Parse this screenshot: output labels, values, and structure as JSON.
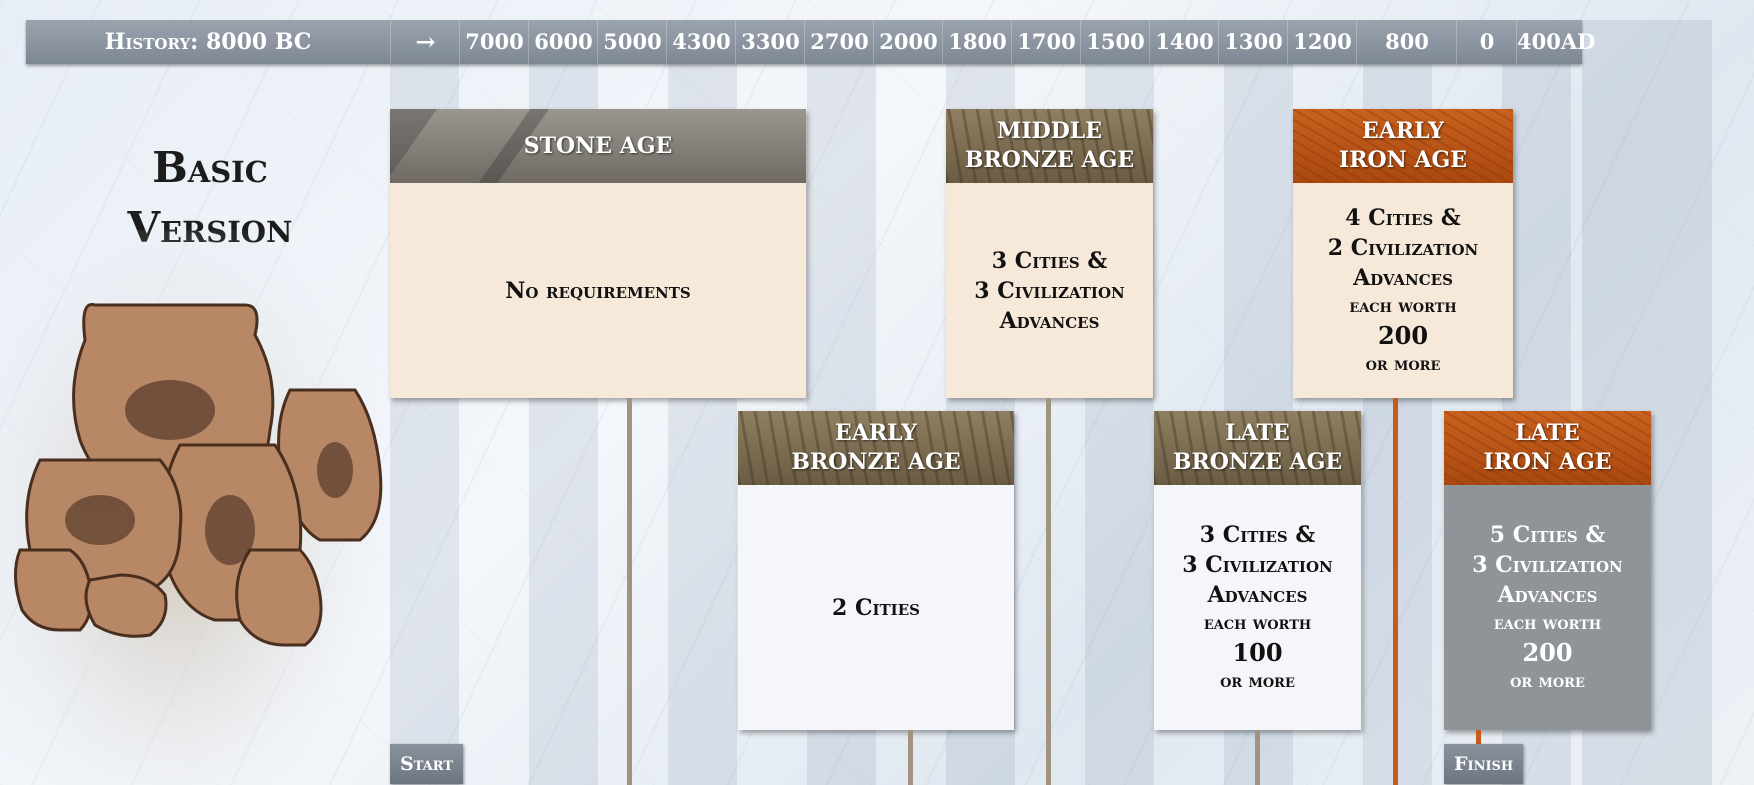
{
  "header": {
    "history_label": "History: 8000 BC",
    "arrow_icon": "→",
    "timeline": [
      "7000",
      "6000",
      "5000",
      "4300",
      "3300",
      "2700",
      "2000",
      "1800",
      "1700",
      "1500",
      "1400",
      "1300",
      "1200",
      "800",
      "0",
      "400AD"
    ]
  },
  "title": {
    "line1": "Basic",
    "line2": "Version"
  },
  "ages": {
    "stone": {
      "name": "STONE AGE",
      "req": "No requirements"
    },
    "early_bronze": {
      "name1": "EARLY",
      "name2": "BRONZE AGE",
      "req": "2 Cities"
    },
    "middle_bronze": {
      "name1": "MIDDLE",
      "name2": "BRONZE AGE",
      "req1": "3 Cities &",
      "req2": "3 Civilization",
      "req3": "Advances"
    },
    "late_bronze": {
      "name1": "LATE",
      "name2": "BRONZE AGE",
      "req1": "3 Cities &",
      "req2": "3 Civilization",
      "req3": "Advances",
      "req4": "each worth",
      "req5": "100",
      "req6": "or more"
    },
    "early_iron": {
      "name1": "EARLY",
      "name2": "IRON AGE",
      "req1": "4 Cities &",
      "req2": "2 Civilization",
      "req3": "Advances",
      "req4": "each worth",
      "req5": "200",
      "req6": "or more"
    },
    "late_iron": {
      "name1": "LATE",
      "name2": "IRON AGE",
      "req1": "5 Cities &",
      "req2": "3 Civilization",
      "req3": "Advances",
      "req4": "each worth",
      "req5": "200",
      "req6": "or more"
    }
  },
  "markers": {
    "start": "Start",
    "finish": "Finish"
  },
  "colors": {
    "iron": "#c0581a",
    "bronze": "#7d6e52",
    "stone": "#86827b",
    "cream": "#f7e9d9",
    "bar": "#8a939d"
  },
  "icons": {
    "arrow": "arrow-right-icon",
    "vases": "greek-pottery-illustration"
  }
}
